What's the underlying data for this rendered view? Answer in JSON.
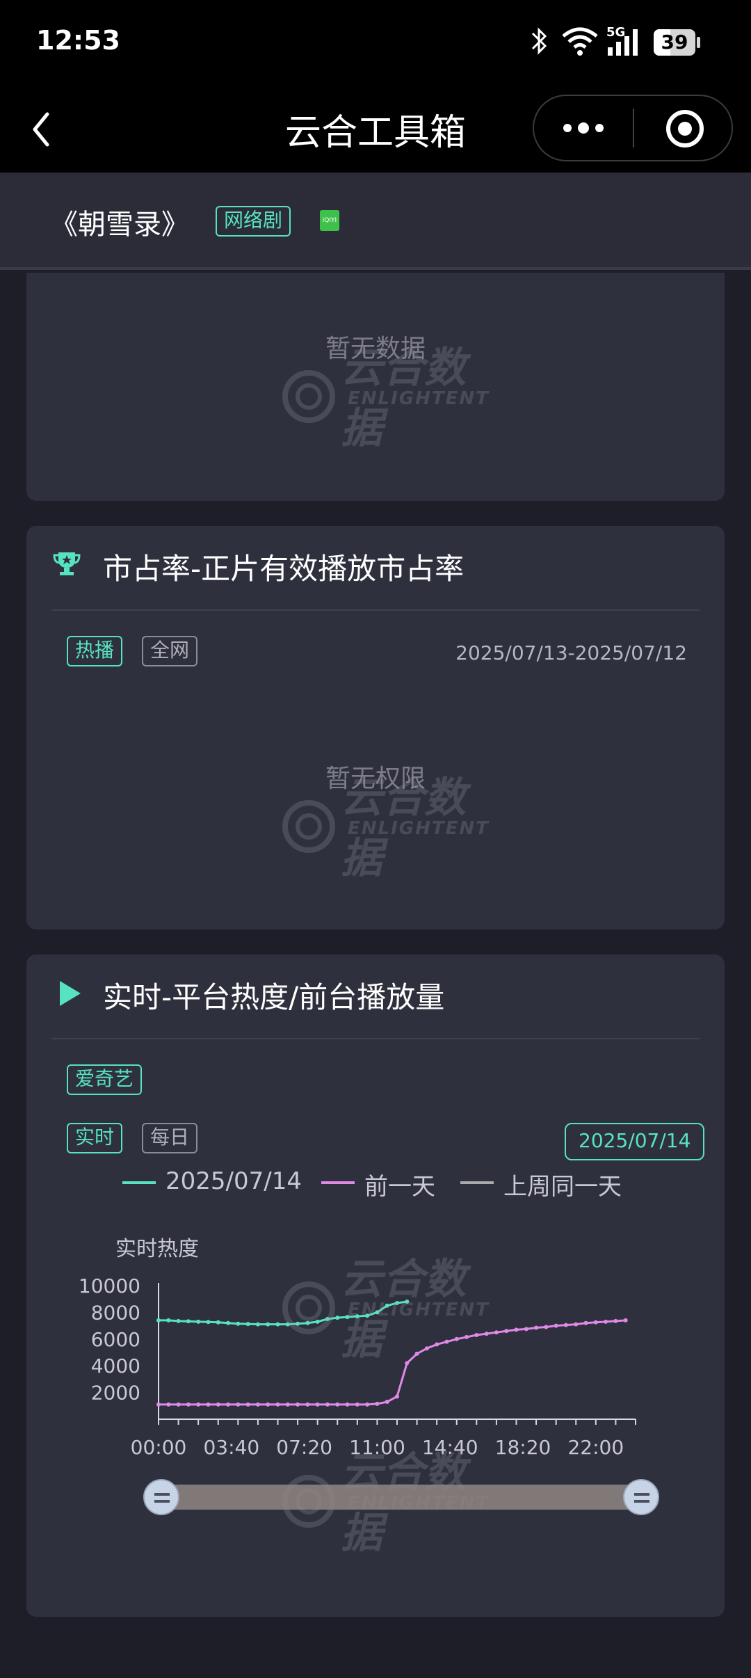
{
  "status_bar": {
    "time": "12:53",
    "battery": "39",
    "network": "5G"
  },
  "nav": {
    "title": "云合工具箱"
  },
  "header": {
    "drama_title": "《朝雪录》",
    "type_tag": "网络剧",
    "platform_icon": "iqiyi-logo"
  },
  "card1": {
    "empty_text": "暂无数据",
    "watermark": "云合数据",
    "watermark_sub": "ENLIGHTENT"
  },
  "card2": {
    "title": "市占率-正片有效播放市占率",
    "icon": "trophy-icon",
    "tabs": [
      "热播",
      "全网"
    ],
    "date_range": "2025/07/13-2025/07/12",
    "empty_text": "暂无权限",
    "watermark": "云合数据",
    "watermark_sub": "ENLIGHTENT"
  },
  "card3": {
    "title": "实时-平台热度/前台播放量",
    "icon": "play-icon",
    "platform_tag": "爱奇艺",
    "tabs": [
      "实时",
      "每日"
    ],
    "date": "2025/07/14",
    "watermark": "云合数据",
    "watermark_sub": "ENLIGHTENT"
  },
  "chart_data": {
    "type": "line",
    "ylabel": "实时热度",
    "yticks": [
      2000,
      4000,
      6000,
      8000,
      10000
    ],
    "ylim": [
      0,
      10000
    ],
    "xticks": [
      "00:00",
      "03:40",
      "07:20",
      "11:00",
      "14:40",
      "18:20",
      "22:00"
    ],
    "xlim_hours": [
      0,
      24
    ],
    "series": [
      {
        "name": "2025/07/14",
        "color": "#57e3c0",
        "x_hours": [
          0,
          0.5,
          1,
          1.5,
          2,
          2.5,
          3,
          3.5,
          4,
          4.5,
          5,
          5.5,
          6,
          6.5,
          7,
          7.5,
          8,
          8.5,
          9,
          9.5,
          10,
          10.5,
          11,
          11.5,
          12,
          12.5
        ],
        "values": [
          7400,
          7400,
          7350,
          7330,
          7300,
          7280,
          7250,
          7200,
          7150,
          7130,
          7100,
          7100,
          7100,
          7100,
          7150,
          7200,
          7300,
          7500,
          7600,
          7650,
          7700,
          7750,
          8000,
          8500,
          8700,
          8800
        ]
      },
      {
        "name": "前一天",
        "color": "#e08ae8",
        "x_hours": [
          0,
          0.5,
          1,
          1.5,
          2,
          2.5,
          3,
          3.5,
          4,
          4.5,
          5,
          5.5,
          6,
          6.5,
          7,
          7.5,
          8,
          8.5,
          9,
          9.5,
          10,
          10.5,
          11,
          11.5,
          12,
          12.5,
          13,
          13.5,
          14,
          14.5,
          15,
          15.5,
          16,
          16.5,
          17,
          17.5,
          18,
          18.5,
          19,
          19.5,
          20,
          20.5,
          21,
          21.5,
          22,
          22.5,
          23,
          23.5
        ],
        "values": [
          1100,
          1100,
          1100,
          1100,
          1100,
          1100,
          1100,
          1100,
          1100,
          1100,
          1100,
          1100,
          1100,
          1100,
          1100,
          1100,
          1100,
          1100,
          1100,
          1100,
          1100,
          1100,
          1150,
          1300,
          1700,
          4200,
          4900,
          5300,
          5600,
          5800,
          6000,
          6150,
          6300,
          6400,
          6500,
          6600,
          6700,
          6750,
          6850,
          6900,
          7000,
          7050,
          7100,
          7200,
          7250,
          7300,
          7350,
          7400
        ]
      },
      {
        "name": "上周同一天",
        "color": "#aaaaaa",
        "x_hours": [],
        "values": []
      }
    ],
    "datazoom": {
      "start": 0,
      "end": 100
    }
  }
}
